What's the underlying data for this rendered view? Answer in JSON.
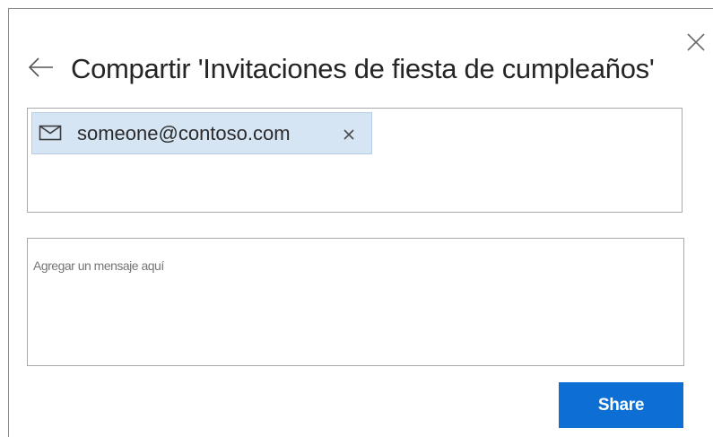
{
  "dialog": {
    "title": "Compartir 'Invitaciones de fiesta de cumpleaños'",
    "back_icon": "arrow-left-icon",
    "close_icon": "close-icon"
  },
  "recipients": {
    "chips": [
      {
        "email": "someone@contoso.com",
        "icon": "mail-envelope-icon",
        "remove_icon": "remove-x-icon"
      }
    ]
  },
  "message": {
    "placeholder": "Agregar un mensaje aquí",
    "value": ""
  },
  "actions": {
    "share_label": "Share"
  },
  "colors": {
    "chip_background": "#d6e5f4",
    "share_button": "#0d6fd4",
    "border": "#a9a9a9"
  }
}
